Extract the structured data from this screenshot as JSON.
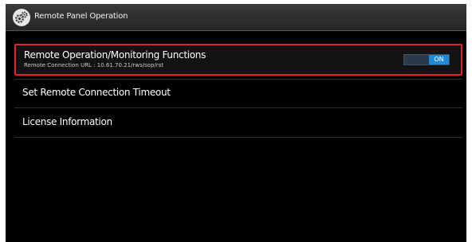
{
  "window": {
    "title": "Remote Panel Operation",
    "icon": "gears-icon"
  },
  "menu": {
    "items": [
      {
        "label": "Remote Operation/Monitoring Functions",
        "sublabel": "Remote Connection URL : 10.61.70.21/rws/sop/rst",
        "toggle_state": "ON",
        "selected": true
      },
      {
        "label": "Set Remote Connection Timeout"
      },
      {
        "label": "License Information"
      }
    ]
  },
  "colors": {
    "selection_border": "#e0232c",
    "toggle_on": "#1f8ad6",
    "background": "#000000"
  }
}
